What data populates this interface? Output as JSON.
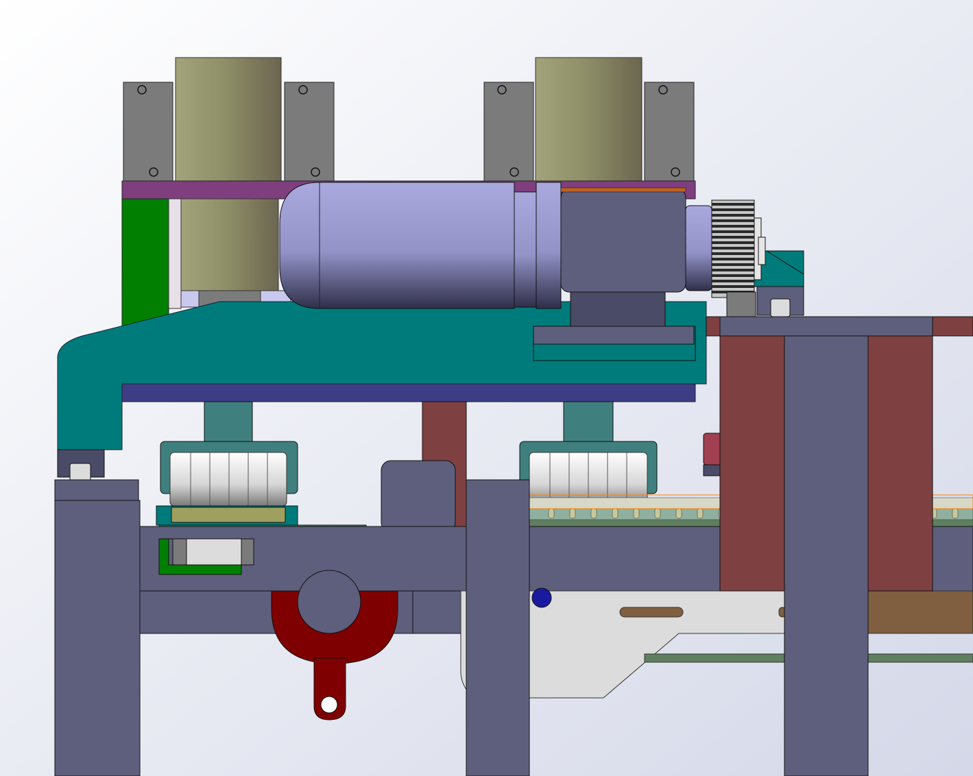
{
  "viewport": {
    "background_top": "#ffffff",
    "background_bottom": "#d8dcea"
  },
  "colors": {
    "frame": "#5e5f7d",
    "frame_dark": "#4a4b66",
    "teal": "#007b7b",
    "teal_light": "#3f807f",
    "navy": "#3d3d86",
    "maroon": "#7f4041",
    "dark_red": "#7f0000",
    "purple_band": "#7f3f7f",
    "green": "#007f00",
    "motor_body": "#a3a3d6",
    "motor_cap": "#5e5f7d",
    "olive_roller": "#9a9a72",
    "grey_block": "#7b7b7b",
    "brown_plate": "#7f5f3f",
    "chrome": "#c8c8c8",
    "highlight_orange": "#ff7f00",
    "light_grey_panel": "#dcdcdc",
    "rail_green": "#5f7f5f"
  },
  "parts": {
    "frame": "machine-frame",
    "motor": "drive-motor",
    "gear": "spur-gear",
    "rollers": "pinch-rollers",
    "drum_left": "supply-drum-left",
    "drum_right": "supply-drum-right",
    "clamp": "red-clamp"
  }
}
